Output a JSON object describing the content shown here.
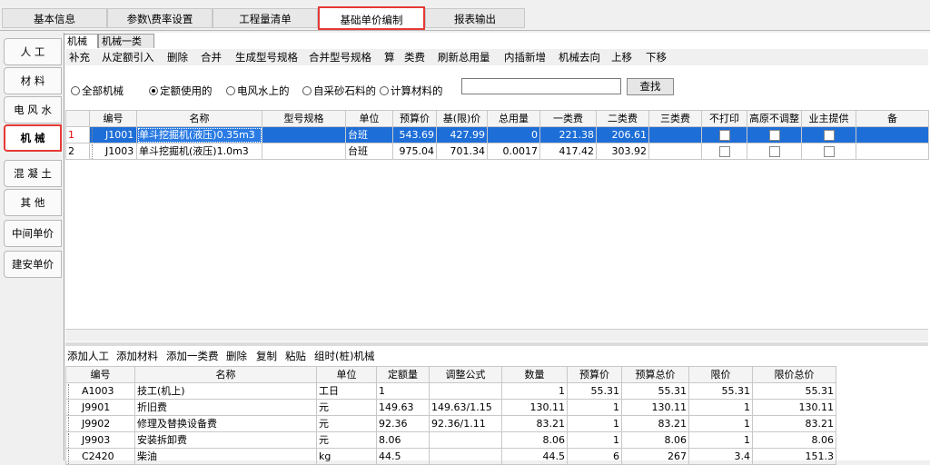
{
  "top_tabs": [
    "基本信息",
    "参数\\费率设置",
    "工程量清单",
    "基础单价编制",
    "报表输出"
  ],
  "side_tabs": [
    "人 工",
    "材 料",
    "电 风 水",
    "机 械",
    "混 凝 土",
    "其 他",
    "中间单价",
    "建安单价"
  ],
  "sub_tabs": [
    "机械",
    "机械一类费"
  ],
  "toolbar1": [
    "补充",
    "从定额引入",
    "删除",
    "合并",
    "生成型号规格",
    "合并型号规格",
    "算",
    "类费",
    "刷新总用量",
    "内插新增",
    "机械去向",
    "上移",
    "下移"
  ],
  "filter": {
    "radios": [
      "全部机械",
      "定额使用的",
      "电风水上的",
      "自采砂石料的",
      "计算材料的"
    ],
    "selected": "定额使用的",
    "search_value": "",
    "search_button": "查找"
  },
  "upper_table": {
    "headers": [
      "",
      "编号",
      "名称",
      "型号规格",
      "单位",
      "预算价",
      "基(限)价",
      "总用量",
      "一类费",
      "二类费",
      "三类费",
      "不打印",
      "高原不调整",
      "业主提供",
      "备"
    ],
    "rows": [
      {
        "no": "1",
        "code": "J1001",
        "name": "单斗挖掘机(液压)0.35m3",
        "spec": "",
        "unit": "台班",
        "budget": "543.69",
        "base": "427.99",
        "total": "0",
        "c1": "221.38",
        "c2": "206.61",
        "c3": ""
      },
      {
        "no": "2",
        "code": "J1003",
        "name": "单斗挖掘机(液压)1.0m3",
        "spec": "",
        "unit": "台班",
        "budget": "975.04",
        "base": "701.34",
        "total": "0.0017",
        "c1": "417.42",
        "c2": "303.92",
        "c3": ""
      }
    ]
  },
  "toolbar2": [
    "添加人工",
    "添加材料",
    "添加一类费",
    "删除",
    "复制",
    "粘贴",
    "组时(桩)机械"
  ],
  "lower_table": {
    "headers": [
      "编号",
      "名称",
      "单位",
      "定额量",
      "调整公式",
      "数量",
      "预算价",
      "预算总价",
      "限价",
      "限价总价"
    ],
    "rows": [
      {
        "code": "A1003",
        "name": "技工(机上)",
        "unit": "工日",
        "quota": "1",
        "formula": "",
        "qty": "1",
        "price": "55.31",
        "total": "55.31",
        "limit": "55.31",
        "limit_total": "55.31"
      },
      {
        "code": "J9901",
        "name": "折旧费",
        "unit": "元",
        "quota": "149.63",
        "formula": "149.63/1.15",
        "qty": "130.11",
        "price": "1",
        "total": "130.11",
        "limit": "1",
        "limit_total": "130.11"
      },
      {
        "code": "J9902",
        "name": "修理及替换设备费",
        "unit": "元",
        "quota": "92.36",
        "formula": "92.36/1.11",
        "qty": "83.21",
        "price": "1",
        "total": "83.21",
        "limit": "1",
        "limit_total": "83.21"
      },
      {
        "code": "J9903",
        "name": "安装拆卸费",
        "unit": "元",
        "quota": "8.06",
        "formula": "",
        "qty": "8.06",
        "price": "1",
        "total": "8.06",
        "limit": "1",
        "limit_total": "8.06"
      },
      {
        "code": "C2420",
        "name": "柴油",
        "unit": "kg",
        "quota": "44.5",
        "formula": "",
        "qty": "44.5",
        "price": "6",
        "total": "267",
        "limit": "3.4",
        "limit_total": "151.3"
      }
    ]
  },
  "colors": {
    "highlight": "#e53935",
    "selection": "#1e6ed8"
  }
}
